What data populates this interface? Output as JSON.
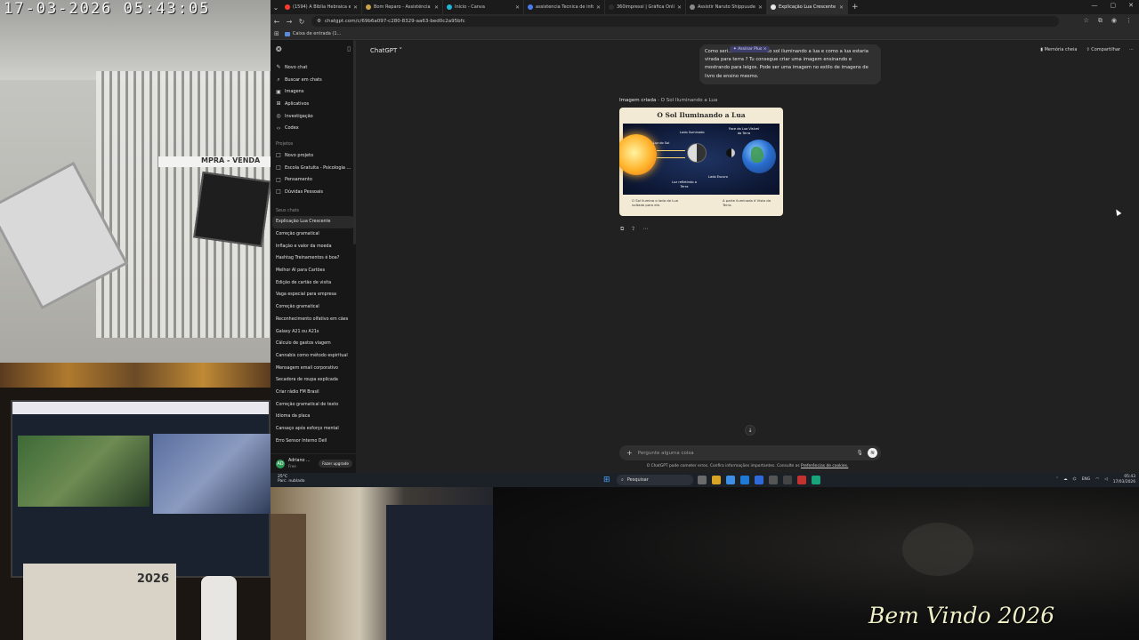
{
  "overlay": {
    "timestamp": "17-03-2026  05:43:05",
    "welcome": "Bem Vindo 2026",
    "cam_sign": "MPRA - VENDA",
    "calendar_year": "2026"
  },
  "browser": {
    "tabs": [
      {
        "label": "(1594) A Bíblia Hebraica em ár...",
        "color": "#ff3b30"
      },
      {
        "label": "Bom Reparo - Assistência Técni...",
        "color": "#c9a24a"
      },
      {
        "label": "Início - Canva",
        "color": "#21b6d8"
      },
      {
        "label": "assistencia Tecnica de informati...",
        "color": "#4a7cf0"
      },
      {
        "label": "360impressi | Gráfica Online, Pr...",
        "color": "#2d2d2d"
      },
      {
        "label": "Assistir Naruto Shippuuden Epi...",
        "color": "#8a8a8a"
      },
      {
        "label": "Explicação Lua Crescente",
        "color": "#e8e8e8",
        "active": true
      }
    ],
    "url": "chatgpt.com/c/69b6a097-c280-8329-aa63-bed0c2a95bfc",
    "bookmark": "Caixa de entrada (1..."
  },
  "sidebar": {
    "nav": [
      {
        "label": "Novo chat",
        "icon": "✎"
      },
      {
        "label": "Buscar em chats",
        "icon": "⌕"
      },
      {
        "label": "Imagens",
        "icon": "▣"
      },
      {
        "label": "Aplicativos",
        "icon": "⊞"
      },
      {
        "label": "Investigação",
        "icon": "◎"
      },
      {
        "label": "Codex",
        "icon": "‹›"
      }
    ],
    "projects_heading": "Projetos",
    "projects": [
      {
        "label": "Novo projeto",
        "icon": "□"
      },
      {
        "label": "Escola Gratuita - Psicologia ...",
        "icon": "□"
      },
      {
        "label": "Pensamento",
        "icon": "□"
      },
      {
        "label": "Dúvidas Pessoais",
        "icon": "□"
      }
    ],
    "chats_heading": "Seus chats",
    "chats": [
      "Explicação Lua Crescente",
      "Correção gramatical",
      "Inflação e valor da moeda",
      "Hashtag Treinamentos é boa?",
      "Melhor AI para Cartões",
      "Edição de cartão de visita",
      "Vaga especial para empresa",
      "Correção gramatical",
      "Reconhecimento olfativo em cães",
      "Galaxy A21 ou A21s",
      "Cálculo de gastos viagem",
      "Cannabis como método espiritual",
      "Mensagem email corporativo",
      "Secadora de roupa explicada",
      "Criar rádio FM Brasil",
      "Correção gramatical de texto",
      "Idioma da placa",
      "Cansaço após esforço mental",
      "Erro Sensor Interno Dell"
    ],
    "user": {
      "initials": "AD",
      "name": "Adriano ...",
      "plan": "Free",
      "upgrade": "Fazer upgrade"
    }
  },
  "main": {
    "model": "ChatGPT ˅",
    "actions": {
      "memory": "Memória cheia",
      "share": "Compartilhar",
      "more": "⋯"
    },
    "plus_badge": "✦ Assinar Plus  ×",
    "user_message": "Como seri... desse retrato do sol iluminando a lua e como a lua estaria virada para terra ? Tu consegue criar uma imagem ensinando e mostrando para leigos. Pode ser uma imagem no estilo de imagens de livro de ensino mesmo.",
    "image_label": "Imagem criada",
    "image_caption": "O Sol Iluminando a Lua",
    "generated": {
      "title": "O Sol Iluminando a Lua",
      "labels": {
        "sun": "Luz do Sol",
        "lit_side": "Lado Iluminado",
        "visible_face": "Face da Lua Visível da Terra",
        "dark_side": "Lado Escuro",
        "lighting": "Luz refletindo a Terra"
      },
      "foot_left": "O Sol ilumina o lado da Lua voltado para ele.",
      "foot_right": "A parte iluminada é Vista da Terra."
    },
    "composer_placeholder": "Pergunte alguma coisa",
    "disclaimer": "O ChatGPT pode cometer erros. Confira informações importantes. Consulte as",
    "disclaimer_link": "Preferências de cookies."
  },
  "taskbar": {
    "weather_temp": "25°C",
    "weather_desc": "Parc. nublado",
    "search": "Pesquisar",
    "lang": "ENG",
    "time": "05:43",
    "date": "17/03/2026"
  }
}
